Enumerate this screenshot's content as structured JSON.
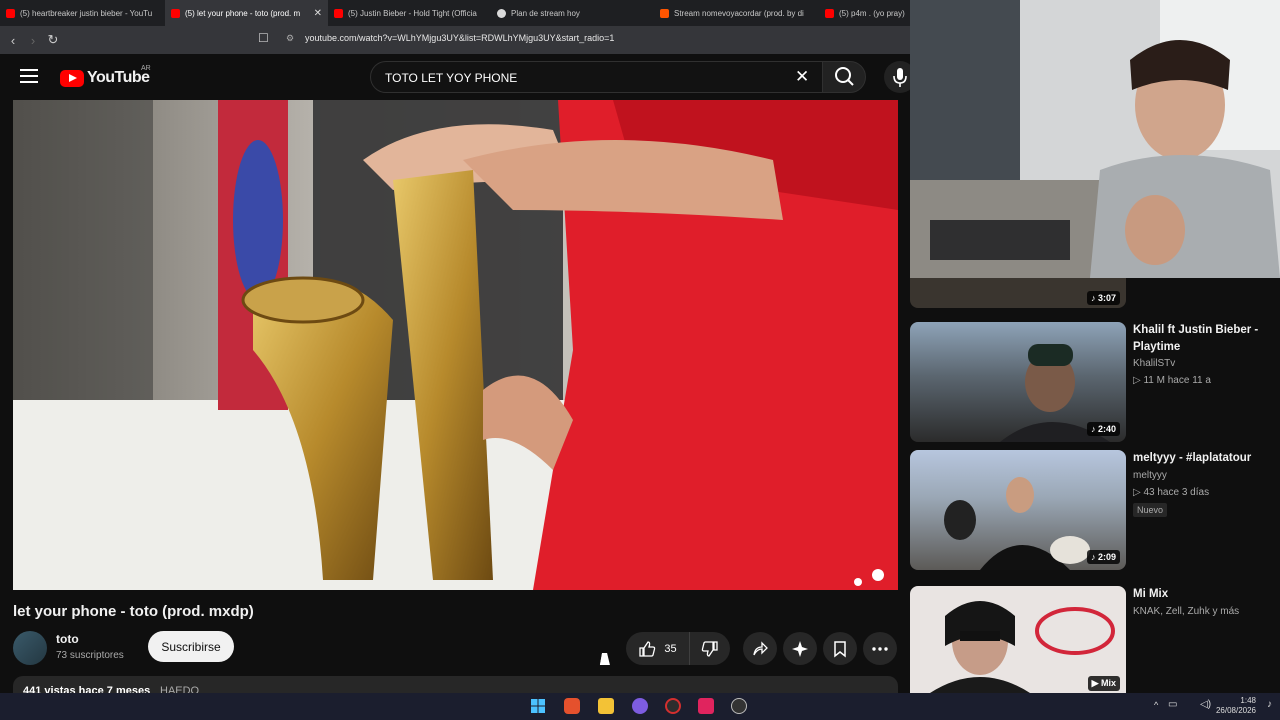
{
  "browser": {
    "tabs": [
      {
        "label": "(5) heartbreaker justin bieber - YouTu",
        "icon": "youtube-icon",
        "active": false
      },
      {
        "label": "(5) let your phone - toto (prod. m",
        "icon": "youtube-icon",
        "active": true
      },
      {
        "label": "(5) Justin Bieber - Hold Tight (Officia",
        "icon": "youtube-icon",
        "active": false
      },
      {
        "label": "Plan de stream hoy",
        "icon": "document-icon",
        "active": false
      },
      {
        "label": "Stream nomevoyacordar (prod. by di",
        "icon": "soundcloud-icon",
        "active": false
      },
      {
        "label": "(5) p4m . (yo pray)",
        "icon": "youtube-icon",
        "active": false
      }
    ],
    "url": "youtube.com/watch?v=WLhYMjgu3UY&list=RDWLhYMjgu3UY&start_radio=1"
  },
  "youtube": {
    "logo_text": "YouTube",
    "country": "AR",
    "search_value": "TOTO LET YOY PHONE"
  },
  "video": {
    "title": "let your phone - toto (prod. mxdp)",
    "channel": "toto",
    "subscribers": "73 suscriptores",
    "subscribe_label": "Suscribirse",
    "likes": "35",
    "views_date": "441 vistas  hace 7 meses",
    "tag": "HAEDO"
  },
  "recommendations": [
    {
      "title": "",
      "channel": "",
      "meta": "",
      "duration": "3:07"
    },
    {
      "title": "Khalil ft  Justin Bieber - Playtime",
      "channel": "KhalilSTv",
      "meta": "11 M  hace 11 a",
      "duration": "2:40"
    },
    {
      "title": "meltyyy - #laplatatour",
      "channel": "meltyyy",
      "meta": "43  hace 3 días",
      "duration": "2:09",
      "badge": "Nuevo"
    },
    {
      "title": "Mi Mix",
      "channel": "KNAK, Zell, Zuhk y más",
      "duration": "Mix"
    }
  ],
  "taskbar": {
    "time": "1:48",
    "date": "26/08/2026"
  },
  "colors": {
    "accent": "#ff0000",
    "background": "#0f0f0f",
    "chip": "#272727"
  }
}
